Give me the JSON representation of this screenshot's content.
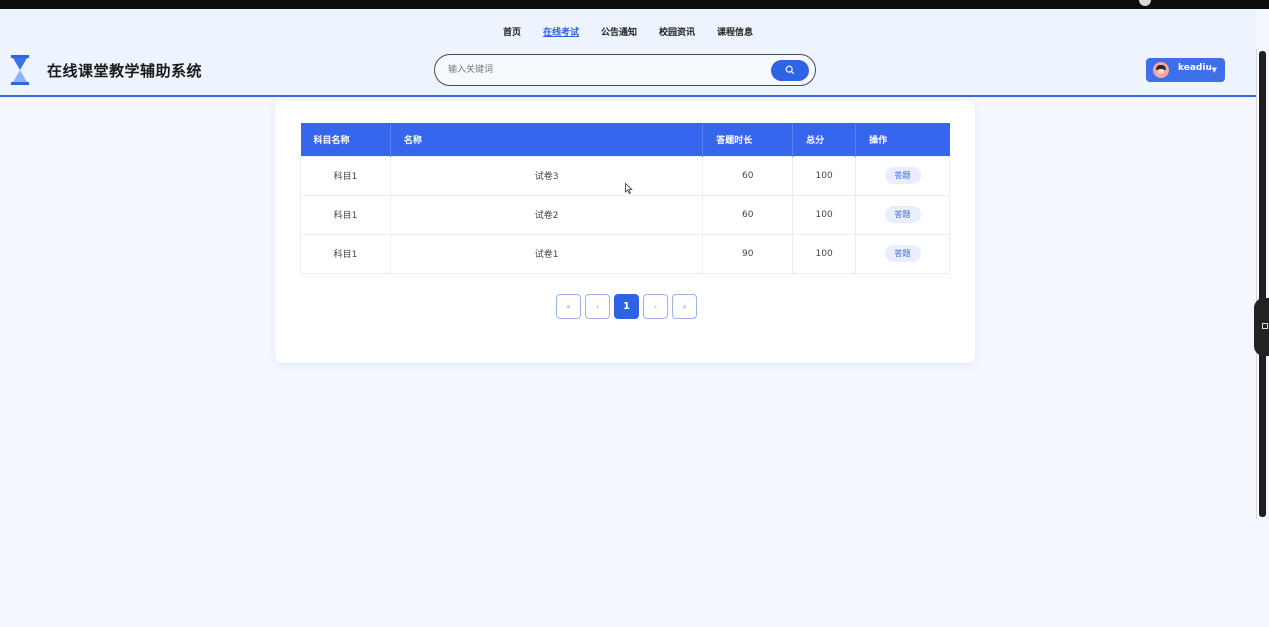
{
  "nav": {
    "items": [
      {
        "label": "首页",
        "active": false
      },
      {
        "label": "在线考试",
        "active": true
      },
      {
        "label": "公告通知",
        "active": false
      },
      {
        "label": "校园资讯",
        "active": false
      },
      {
        "label": "课程信息",
        "active": false
      }
    ]
  },
  "app": {
    "title": "在线课堂教学辅助系统"
  },
  "search": {
    "placeholder": "输入关键词"
  },
  "user": {
    "name": "keadiu"
  },
  "table": {
    "headers": [
      "科目名称",
      "名称",
      "答题时长",
      "总分",
      "操作"
    ],
    "rows": [
      {
        "subject": "科目1",
        "name": "试卷3",
        "duration": "60",
        "score": "100",
        "action": "答题"
      },
      {
        "subject": "科目1",
        "name": "试卷2",
        "duration": "60",
        "score": "100",
        "action": "答题"
      },
      {
        "subject": "科目1",
        "name": "试卷1",
        "duration": "90",
        "score": "100",
        "action": "答题"
      }
    ]
  },
  "pager": {
    "first": "«",
    "prev": "‹",
    "current": "1",
    "next": "›",
    "last": "»"
  },
  "colors": {
    "accent": "#2f63e6",
    "header_row": "#3766ee",
    "background": "#f4f7fd"
  }
}
